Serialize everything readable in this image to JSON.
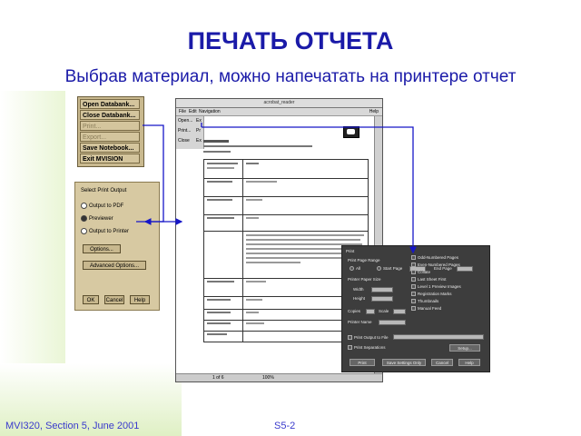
{
  "slide": {
    "title": "ПЕЧАТЬ ОТЧЕТА",
    "subtitle": "Выбрав материал, можно напечатать на принтере отчет",
    "footer_left": "MVI320, Section 5, June 2001",
    "footer_right": "S5-2"
  },
  "file_menu": {
    "items": [
      {
        "label": "Open Databank...",
        "enabled": true
      },
      {
        "label": "Close Databank...",
        "enabled": true
      },
      {
        "label": "Print...",
        "enabled": false
      },
      {
        "label": "Export...",
        "enabled": false
      },
      {
        "label": "Save Notebook...",
        "enabled": true
      },
      {
        "label": "Exit MVISION",
        "enabled": true
      }
    ]
  },
  "select_print_output": {
    "title": "Select Print Output",
    "options": [
      "Output to PDF",
      "Previewer",
      "Output to Printer"
    ],
    "selected": "Previewer",
    "options_button": "Options...",
    "advanced_button": "Advanced Options...",
    "ok": "OK",
    "cancel": "Cancel",
    "help": "Help"
  },
  "report_window": {
    "title": "acrobat_reader",
    "menu": [
      "File",
      "Edit",
      "Navigation"
    ],
    "menu_help": "Help",
    "side_items": [
      "Open...",
      "Print...",
      "Close"
    ],
    "side_items_right": [
      "Ex",
      "Pr",
      "Ex"
    ],
    "status_left": "1 of 6",
    "status_zoom": "100%"
  },
  "print_dialog": {
    "title": "Print",
    "print_page_range": "Print Page Range",
    "all": "All",
    "start_page": "Start Page",
    "end_page": "End Page",
    "printer_paper_size": "Printer Paper Size",
    "width": "Width",
    "height": "Height",
    "copies": "Copies",
    "scale": "Scale",
    "printer_name": "Printer Name",
    "print_to_file": "Print Output to File",
    "print_separations": "Print Separations",
    "checkboxes": [
      "Odd-Numbered Pages",
      "Even-Numbered Pages",
      "Collate",
      "Last Sheet First",
      "Level 1 Preview Images",
      "Registration Marks",
      "Thumbnails",
      "Manual Feed"
    ],
    "buttons": [
      "Print",
      "Save Settings Only",
      "Cancel",
      "Help"
    ],
    "setup_button": "Setup..."
  },
  "colors": {
    "title": "#1a1aa8",
    "arrow": "#1616c8",
    "menu_bg": "#c9b98f",
    "dialog_bg": "#3d3d3d"
  }
}
